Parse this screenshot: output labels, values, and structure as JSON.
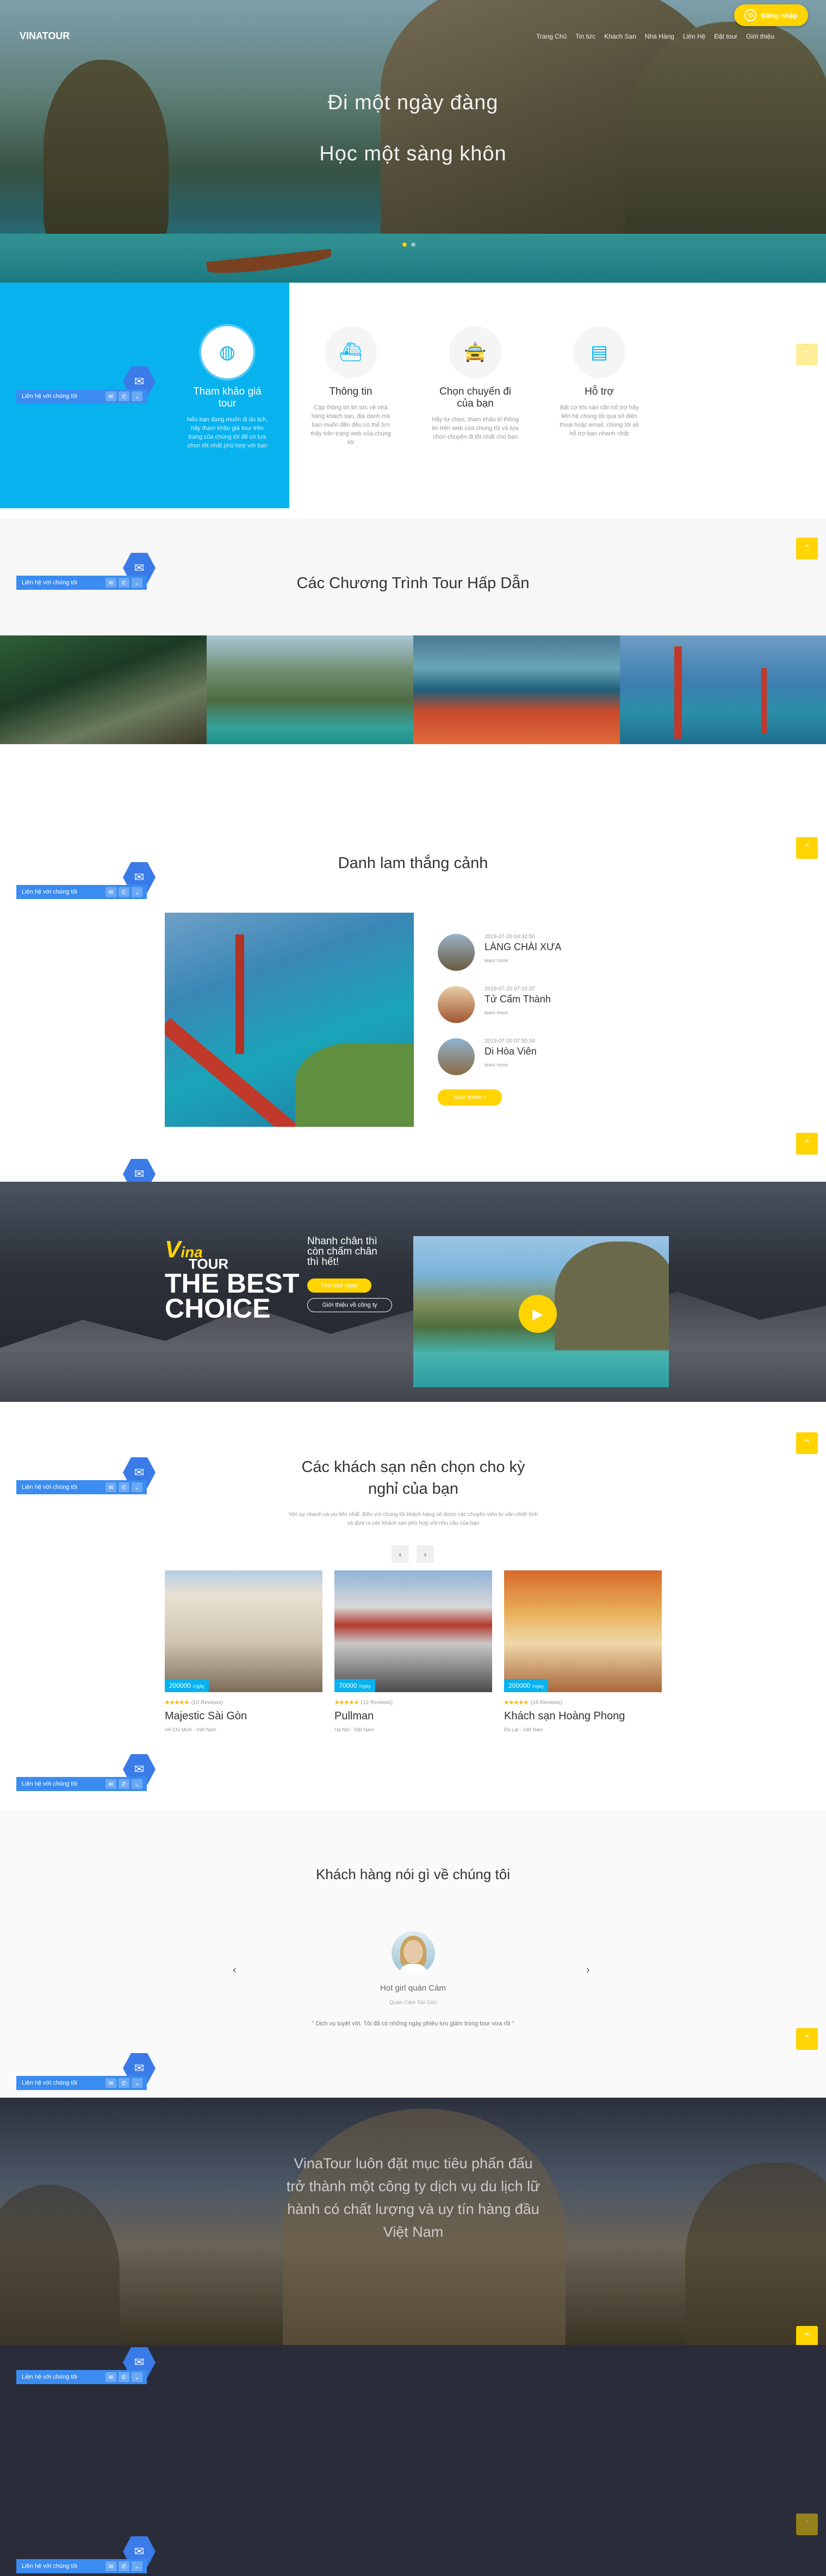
{
  "header": {
    "logo": "VINATOUR",
    "nav": [
      "Trang Chủ",
      "Tin tức",
      "Khách Sạn",
      "Nhà Hàng",
      "Liên Hệ",
      "Đặt tour",
      "Giới thiệu"
    ],
    "signup": "Đăng nhập"
  },
  "hero": {
    "line1": "Đi một ngày đàng",
    "line2": "Học một sàng khôn"
  },
  "features": [
    {
      "icon": "globe-icon",
      "title": "Tham khảo giá tour",
      "text": "Nếu bạn đang muốn đi du lịch, hãy tham khảo giá tour trên trang của chúng tôi để có lựa chọn tốt nhất phù hợp với bạn"
    },
    {
      "icon": "ship-icon",
      "title": "Thông tin",
      "text": "Cập thông tin tin tức về nhà hàng khách sạn, địa danh mà bạn muốn đến đều có thể tìm thấy trên trang web của chúng tôi"
    },
    {
      "icon": "car-icon",
      "title": "Chọn chuyến đi của bạn",
      "text": "Hãy tự chọn, tham khảo kĩ thông tin trên web của chúng tôi và lựa chọn chuyến đi tốt nhất cho bạn"
    },
    {
      "icon": "support-icon",
      "title": "Hỗ trợ",
      "text": "Bất cứ khi nào cần hỗ trợ hãy liên hệ chúng tôi qua số điện thoại hoặc email, chúng tôi sẽ hỗ trợ bạn nhanh nhất"
    }
  ],
  "contact_widget": {
    "label": "Liên hệ với chúng tôi"
  },
  "tours": {
    "title": "Các Chương Trình Tour Hấp Dẫn"
  },
  "landscape": {
    "title": "Danh lam thắng cảnh",
    "items": [
      {
        "date": "2019-07-20 04:42:50",
        "name": "LÀNG CHÀI XƯA",
        "more": "learn more"
      },
      {
        "date": "2019-07-20 07:10:37",
        "name": "Tử Cấm Thành",
        "more": "learn more"
      },
      {
        "date": "2019-07-20 07:50:34",
        "name": "Di Hòa Viên",
        "more": "learn more"
      }
    ],
    "view_more": "Xem thêm >"
  },
  "best": {
    "logo_v": "V",
    "logo_ina": "ina",
    "logo_tour": "TOUR",
    "big": "THE BEST CHOICE",
    "text": "Nhanh chân thì còn chấm chân thì hết!",
    "btn1": "Tìm tour ngay",
    "btn2": "Giới thiệu về công ty"
  },
  "hotels": {
    "title": "Các khách sạn nên chọn cho kỳ nghỉ của bạn",
    "sub": "Với sự nhanh và ưu tiên nhất. Đến với chúng tôi khách hàng sẽ được các chuyên viên tư vấn nhiệt tình và đưa ra các khách sạn phù hợp với nhu cầu của bạn",
    "list": [
      {
        "price": "200000",
        "unit": "/ngày",
        "stars": "★★★★★",
        "reviews": "(10 Reviews)",
        "name": "Majestic Sài Gòn",
        "loc": "Hồ Chí Minh - Việt Nam"
      },
      {
        "price": "70000",
        "unit": "/ngày",
        "stars": "★★★★★",
        "reviews": "(12 Reviews)",
        "name": "Pullman",
        "loc": "Hà Nội - Việt Nam"
      },
      {
        "price": "200000",
        "unit": "/ngày",
        "stars": "★★★★★",
        "reviews": "(18 Reviews)",
        "name": "Khách sạn Hoàng Phong",
        "loc": "Đà Lạt - Việt Nam"
      }
    ]
  },
  "testimonial": {
    "title": "Khách hàng nói gì về chúng tôi",
    "name": "Hot girl quán Cám",
    "role": "Quán Cám Sài Gòn",
    "quote": "\" Dịch vụ tuyệt vời. Tôi đã có những ngày phiêu lưu giảm trong tour vừa rồi \""
  },
  "banner": {
    "quote": "VinaTour luôn đặt mục tiêu phấn đấu trở thành một công ty dịch vụ du lịch lữ hành có chất lượng và uy tín hàng đầu Việt Nam"
  },
  "colors": {
    "accent": "#08b2ef",
    "yellow": "#ffd400",
    "widget": "#3b8cf0"
  }
}
